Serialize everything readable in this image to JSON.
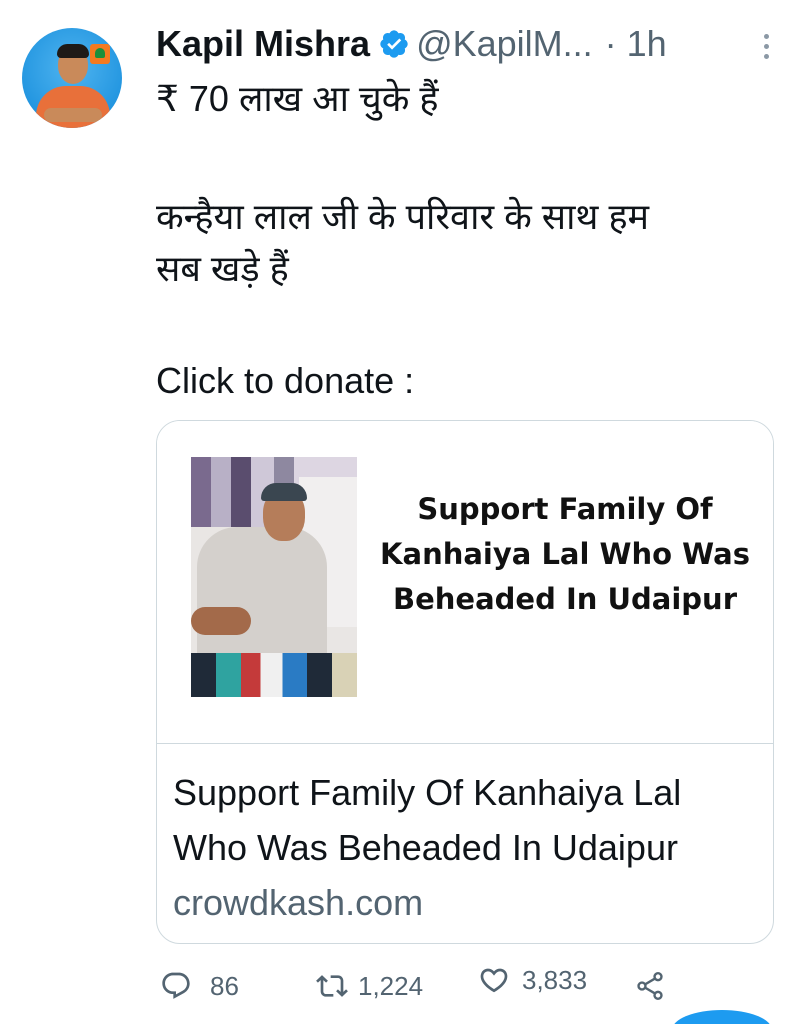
{
  "tweet": {
    "author": {
      "name": "Kapil Mishra",
      "handle": "@KapilM...",
      "separator": "·",
      "time": "1h",
      "verified": true
    },
    "lines": [
      "₹ 70 लाख आ चुके हैं",
      "कन्हैया लाल जी के परिवार के साथ हम",
      "सब खड़े हैं",
      "Click to donate :"
    ],
    "card": {
      "image_text": [
        "Support Family Of",
        "Kanhaiya Lal Who Was",
        "Beheaded In Udaipur"
      ],
      "title_lines": [
        "Support Family Of Kanhaiya Lal",
        "Who Was Beheaded In Udaipur"
      ],
      "domain": "crowdkash.com"
    },
    "stats": {
      "replies": "86",
      "retweets": "1,224",
      "likes": "3,833"
    }
  },
  "colors": {
    "text": "#0f1419",
    "secondary": "#536471",
    "verified": "#1d9bf0",
    "border": "#cfd9de",
    "avatar_bg": "#2396e0"
  },
  "icons": [
    "reply-icon",
    "retweet-icon",
    "like-icon",
    "share-icon",
    "verified-badge-icon",
    "more-options-icon"
  ]
}
